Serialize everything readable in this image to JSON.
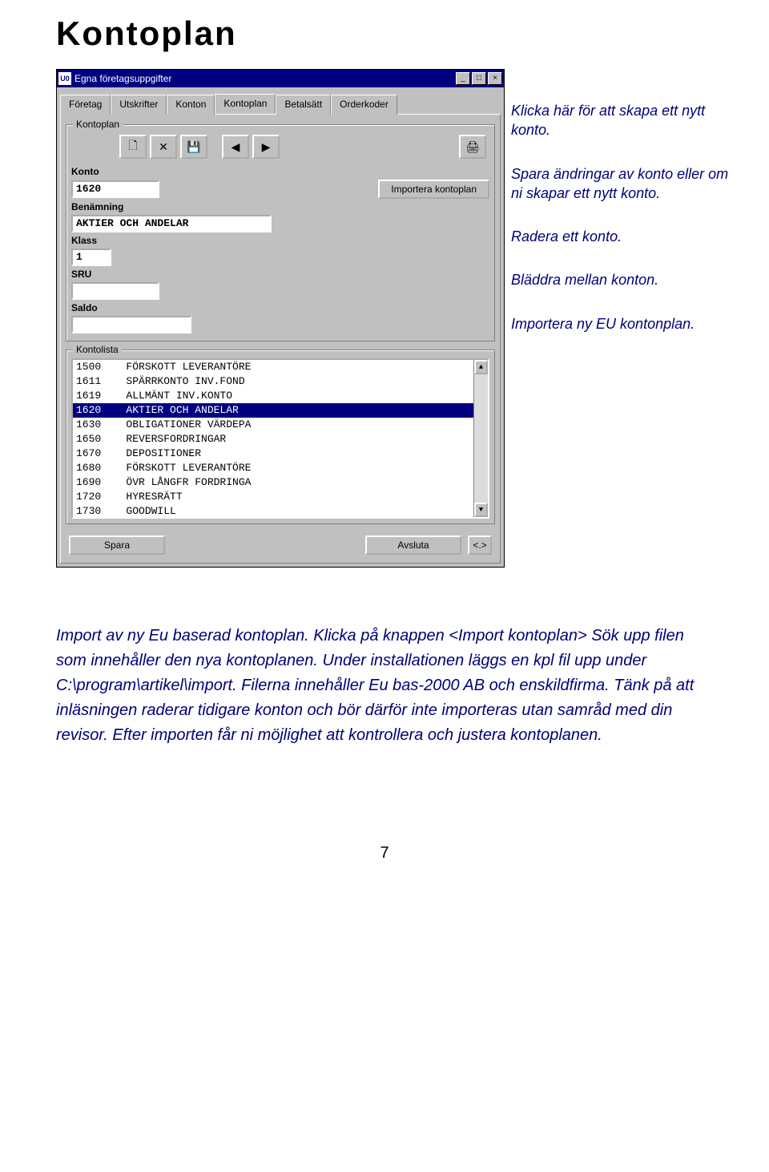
{
  "page_title": "Kontoplan",
  "window": {
    "app_icon_text": "U0",
    "title": "Egna företagsuppgifter",
    "controls": {
      "min": "_",
      "max": "□",
      "close": "×"
    },
    "tabs": [
      "Företag",
      "Utskrifter",
      "Konton",
      "Kontoplan",
      "Betalsätt",
      "Orderkoder"
    ],
    "active_tab": 3,
    "group1_label": "Kontoplan",
    "toolbar_icons": {
      "new": "🗋",
      "delete": "✕",
      "save": "💾",
      "prev": "◀",
      "next": "▶",
      "print": "🖨"
    },
    "fields": {
      "konto_label": "Konto",
      "konto_value": "1620",
      "benamning_label": "Benämning",
      "benamning_value": "AKTIER OCH ANDELAR",
      "klass_label": "Klass",
      "klass_value": "1",
      "sru_label": "SRU",
      "sru_value": "",
      "saldo_label": "Saldo",
      "saldo_value": ""
    },
    "import_button": "Importera kontoplan",
    "group2_label": "Kontolista",
    "list": [
      {
        "code": "1500",
        "name": "FÖRSKOTT LEVERANTÖRE",
        "sel": false
      },
      {
        "code": "1611",
        "name": "SPÄRRKONTO INV.FOND",
        "sel": false
      },
      {
        "code": "1619",
        "name": "ALLMÄNT INV.KONTO",
        "sel": false
      },
      {
        "code": "1620",
        "name": "AKTIER OCH ANDELAR",
        "sel": true
      },
      {
        "code": "1630",
        "name": "OBLIGATIONER VÄRDEPA",
        "sel": false
      },
      {
        "code": "1650",
        "name": "REVERSFORDRINGAR",
        "sel": false
      },
      {
        "code": "1670",
        "name": "DEPOSITIONER",
        "sel": false
      },
      {
        "code": "1680",
        "name": "FÖRSKOTT LEVERANTÖRE",
        "sel": false
      },
      {
        "code": "1690",
        "name": "ÖVR LÅNGFR FORDRINGA",
        "sel": false
      },
      {
        "code": "1720",
        "name": "HYRESRÄTT",
        "sel": false
      },
      {
        "code": "1730",
        "name": "GOODWILL",
        "sel": false
      }
    ],
    "scroll": {
      "up": "▲",
      "down": "▼"
    },
    "buttons": {
      "spara": "Spara",
      "avsluta": "Avsluta",
      "help": "<.>"
    }
  },
  "captions": {
    "c1": "Klicka här för att skapa ett nytt konto.",
    "c2": "Spara ändringar av konto eller om ni skapar ett nytt konto.",
    "c3": "Radera ett konto.",
    "c4": "Bläddra mellan konton.",
    "c5": "Importera ny EU kontonplan."
  },
  "body_text": "Import av ny Eu baserad kontoplan. Klicka på knappen <Import kontoplan> Sök upp filen som innehåller den nya kontoplanen. Under installationen läggs en kpl fil upp under C:\\program\\artikel\\import. Filerna innehåller Eu bas-2000 AB och enskildfirma. Tänk på att inläsningen raderar tidigare konton och bör därför inte importeras utan samråd med din revisor. Efter importen får ni möjlighet att kontrollera och justera kontoplanen.",
  "page_number": "7"
}
